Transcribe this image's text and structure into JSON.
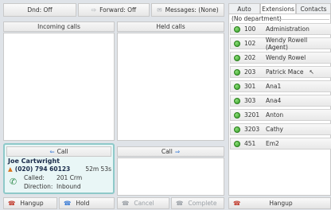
{
  "toolbar": {
    "dnd_label": "Dnd: Off",
    "forward_label": "Forward: Off",
    "messages_label": "Messages: (None)"
  },
  "incoming": {
    "header": "Incoming calls"
  },
  "held": {
    "header": "Held calls"
  },
  "call_card": {
    "tab_left": "Call",
    "tab_right": "Call",
    "name": "Joe Cartwright",
    "number": "(020) 794 60123",
    "duration": "52m 53s",
    "called_label": "Called:",
    "called_value": "201 Crm",
    "direction_label": "Direction:",
    "direction_value": "Inbound"
  },
  "actions": {
    "hangup": "Hangup",
    "hold": "Hold",
    "cancel": "Cancel",
    "complete": "Complete",
    "hangup_right": "Hangup"
  },
  "tabs": {
    "auto": "Auto",
    "extensions": "Extensions",
    "contacts": "Contacts"
  },
  "department": "(No department)",
  "extensions": [
    {
      "num": "100",
      "name": "Administration"
    },
    {
      "num": "102",
      "name": "Wendy Rowell (Agent)"
    },
    {
      "num": "202",
      "name": "Wendy Rowel"
    },
    {
      "num": "203",
      "name": "Patrick Mace"
    },
    {
      "num": "301",
      "name": "Ana1"
    },
    {
      "num": "303",
      "name": "Ana4"
    },
    {
      "num": "3201",
      "name": "Anton"
    },
    {
      "num": "3203",
      "name": "Cathy"
    },
    {
      "num": "451",
      "name": "Em2"
    }
  ],
  "colors": {
    "status_green": "#2f9a22",
    "card_border": "#8ec9c9",
    "card_bg": "#e9f6f6"
  }
}
